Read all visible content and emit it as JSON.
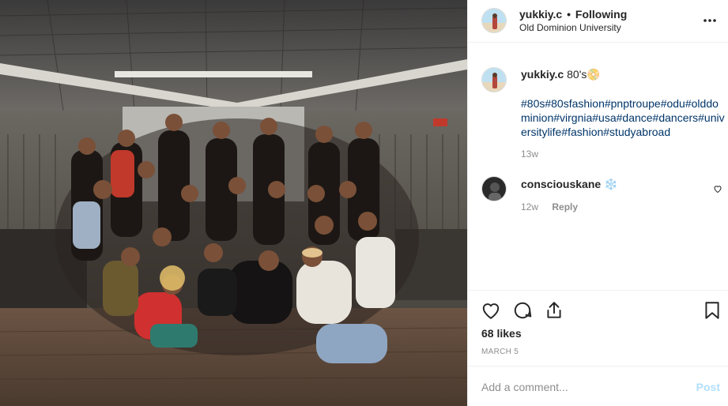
{
  "post": {
    "username": "yukkiy.c",
    "separator": "•",
    "follow_status": "Following",
    "location": "Old Dominion University",
    "caption_user": "yukkiy.c",
    "caption_text": "80's",
    "caption_emoji": "📀",
    "hashtags": "#80s#80sfashion#pnptroupe#odu#olddominion#virgnia#usa#dance#dancers#universitylife#fashion#studyabroad",
    "caption_time": "13w"
  },
  "comments": [
    {
      "username": "consciouskane",
      "text": "❄️",
      "time": "12w",
      "reply_label": "Reply"
    }
  ],
  "engagement": {
    "likes": "68 likes",
    "date": "MARCH 5"
  },
  "add_comment": {
    "placeholder": "Add a comment...",
    "post_label": "Post"
  },
  "icons": {
    "more": "more-options-icon",
    "like": "heart-icon",
    "comment": "comment-icon",
    "share": "share-icon",
    "save": "bookmark-icon"
  }
}
